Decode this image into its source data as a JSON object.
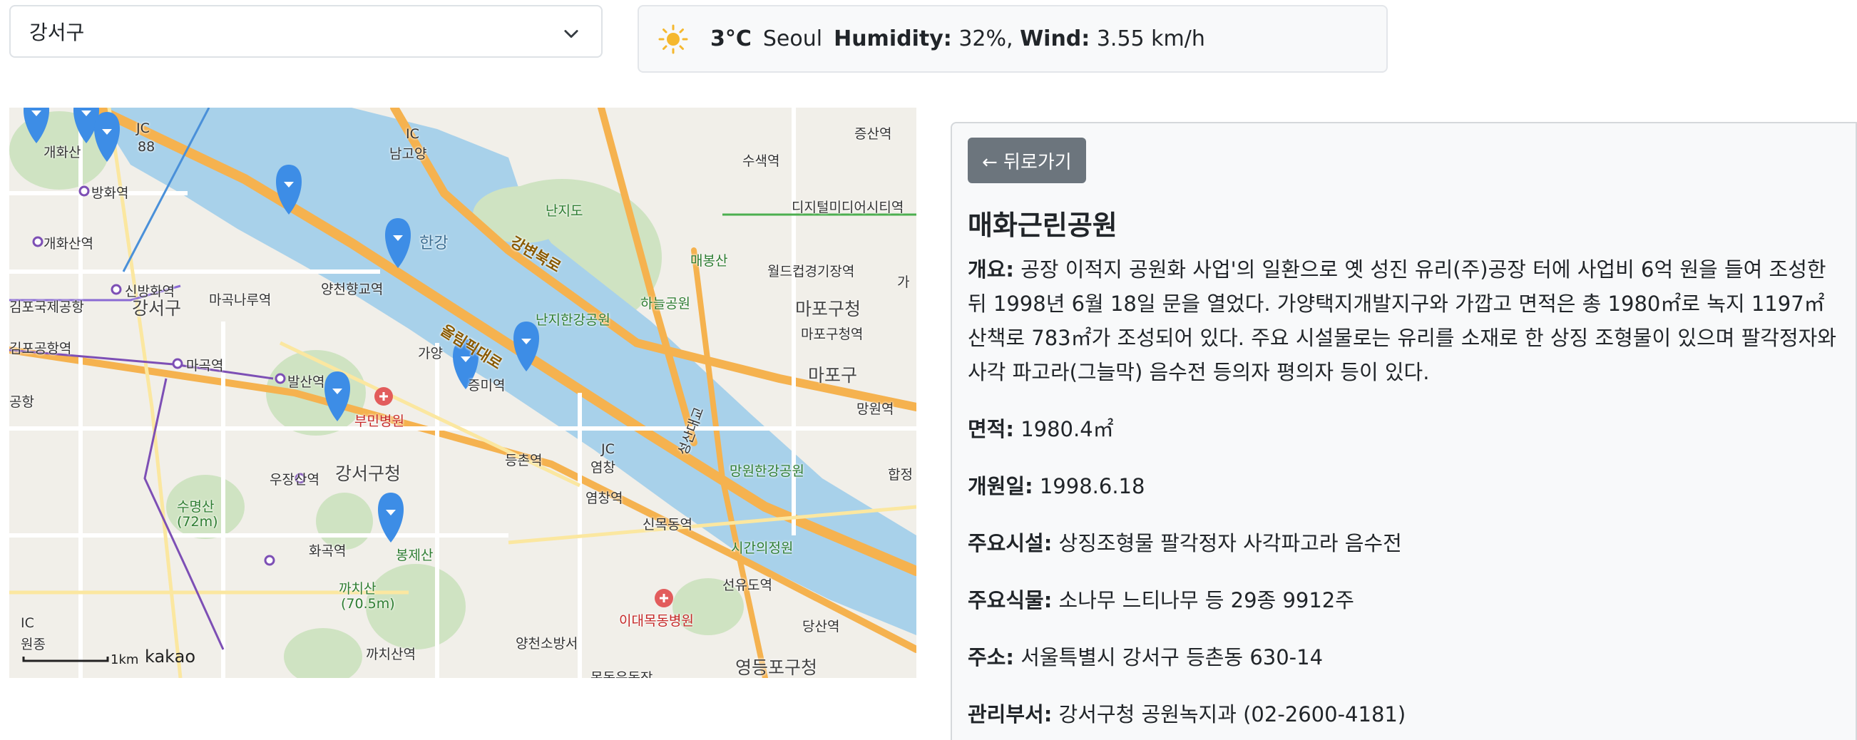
{
  "district_select": {
    "value": "강서구"
  },
  "weather": {
    "icon": "sun-icon",
    "temp": "3°C",
    "city": "Seoul",
    "humidity_label": "Humidity:",
    "humidity_value": "32%,",
    "wind_label": "Wind:",
    "wind_value": "3.55 km/h"
  },
  "map": {
    "labels": {
      "gaehwasan": "개화산",
      "banghwa": "방화역",
      "gaehwasan_st": "개화산역",
      "sinbanghwa": "신방화역",
      "gangseo": "강서구",
      "magoknaru": "마곡나루역",
      "gimpo_intl": "김포국제공항",
      "gimpo_st": "김포공항역",
      "gongang": "공항",
      "magok": "마곡역",
      "balsan": "발산역",
      "yangcheon": "양천향교역",
      "gayang": "가양",
      "jeungmi": "증미역",
      "bumin": "부민병원",
      "gangseo_office": "강서구청",
      "deungchon": "등촌역",
      "yeomchang": "염창역",
      "yeomchang2": "염창",
      "ujangsan": "우장산역",
      "sumyeongsan": "수명산",
      "sumyeongsan_h": "(72m)",
      "hwagok": "화곡역",
      "bongjesan": "봉제산",
      "kkachisan": "까치산",
      "kkachisan_h": "(70.5m)",
      "kkachisan_st": "까치산역",
      "namgoyang": "남고양",
      "nanjido": "난지도",
      "hangang": "한강",
      "gangbyeon": "강변북로",
      "olympic": "올림픽대로",
      "nanji_park": "난지한강공원",
      "haneul": "하늘공원",
      "maebongsan": "매봉산",
      "worldcup": "월드컵경기장역",
      "mapo_office": "마포구청",
      "mapo_office_st": "마포구청역",
      "mapo": "마포구",
      "mangwon": "망원역",
      "mangwon_park": "망원한강공원",
      "seongsan": "성산대교",
      "sinmokdong": "신목동역",
      "sigan": "시간의정원",
      "seonyudo": "선유도역",
      "idaemok": "이대목동병원",
      "dangsan": "당산역",
      "yangcheon_fire": "양천소방서",
      "mokdong": "목동운동장",
      "ydp_office": "영등포구청",
      "hapjeong": "합정",
      "digital": "디지털미디어시티역",
      "susaek": "수색역",
      "jeungsan": "증산역",
      "ga": "가",
      "wonjong": "원종",
      "ic1": "IC",
      "ic2": "IC",
      "jc1": "JC",
      "jc2": "JC",
      "road88": "88"
    },
    "scale_label": "1km",
    "logo": "kakao",
    "markers": [
      {
        "name": "marker-1"
      },
      {
        "name": "marker-2"
      },
      {
        "name": "marker-3"
      },
      {
        "name": "marker-4"
      },
      {
        "name": "marker-5"
      },
      {
        "name": "marker-6"
      },
      {
        "name": "marker-7"
      },
      {
        "name": "marker-8"
      },
      {
        "name": "marker-9"
      }
    ]
  },
  "detail": {
    "back_label": "← 뒤로가기",
    "title": "매화근린공원",
    "overview_label": "개요:",
    "overview_text": "공장 이적지 공원화 사업'의 일환으로 옛 성진 유리(주)공장 터에 사업비 6억 원을 들여 조성한 뒤 1998년 6월 18일 문을 열었다. 가양택지개발지구와 가깝고 면적은 총 1980㎡로 녹지 1197㎡ 산책로 783㎡가 조성되어 있다. 주요 시설물로는 유리를 소재로 한 상징 조형물이 있으며 팔각정자와 사각 파고라(그늘막) 음수전 등의자 평의자 등이 있다.",
    "rows": [
      {
        "label": "면적:",
        "value": "1980.4㎡"
      },
      {
        "label": "개원일:",
        "value": "1998.6.18"
      },
      {
        "label": "주요시설:",
        "value": "상징조형물 팔각정자 사각파고라 음수전"
      },
      {
        "label": "주요식물:",
        "value": "소나무 느티나무 등 29종 9912주"
      },
      {
        "label": "주소:",
        "value": "서울특별시 강서구 등촌동 630-14"
      },
      {
        "label": "관리부서:",
        "value": "강서구청 공원녹지과 (02-2600-4181)"
      }
    ]
  }
}
